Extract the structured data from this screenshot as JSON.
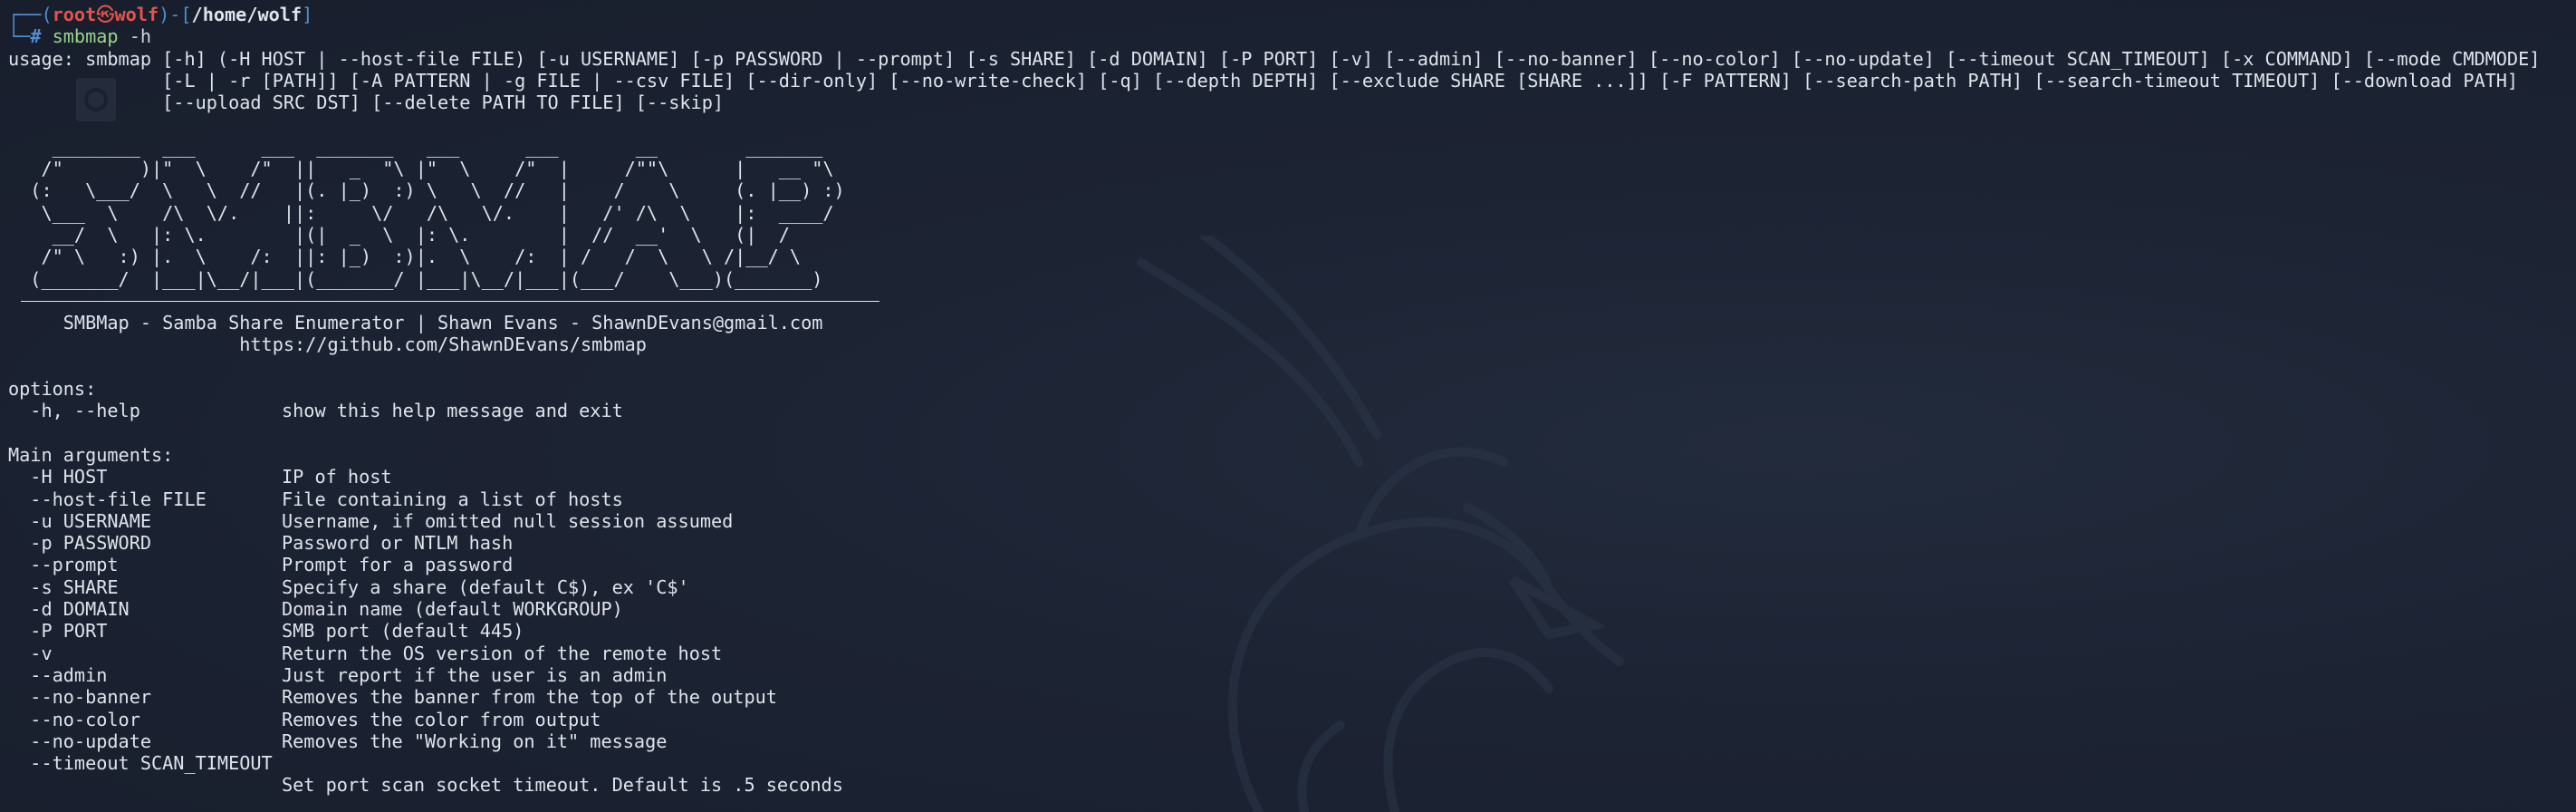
{
  "prompt": {
    "frame_top_left": "┌──(",
    "user": "root",
    "skull": "㉿",
    "host": "wolf",
    "mid": ")-[",
    "path": "/home/wolf",
    "close": "]",
    "frame_bottom": "└─",
    "hash": "# ",
    "command": "smbmap",
    "argument": " -h"
  },
  "usage_lines": [
    "usage: smbmap [-h] (-H HOST | --host-file FILE) [-u USERNAME] [-p PASSWORD | --prompt] [-s SHARE] [-d DOMAIN] [-P PORT] [-v] [--admin] [--no-banner] [--no-color] [--no-update] [--timeout SCAN_TIMEOUT] [-x COMMAND] [--mode CMDMODE]",
    "              [-L | -r [PATH]] [-A PATTERN | -g FILE | --csv FILE] [--dir-only] [--no-write-check] [-q] [--depth DEPTH] [--exclude SHARE [SHARE ...]] [-F PATTERN] [--search-path PATH] [--search-timeout TIMEOUT] [--download PATH]",
    "              [--upload SRC DST] [--delete PATH TO FILE] [--skip]"
  ],
  "banner_art": [
    "",
    "    ________  ___      ___  _______   ___      ___       __        _______",
    "   /\"       )|\"  \\    /\"  ||   _  \"\\ |\"  \\    /\"  |     /\"\"\\      |   __ \"\\",
    "  (:   \\___/  \\   \\  //   |(. |_)  :) \\   \\  //   |    /    \\     (. |__) :)",
    "   \\___  \\    /\\  \\/.    ||:     \\/   /\\   \\/.    |   /' /\\  \\    |:  ____/",
    "    __/  \\   |: \\.        |(|  _  \\  |: \\.        |  //  __'  \\   (|  /",
    "   /\" \\   :) |.  \\    /:  ||: |_)  :)|.  \\    /:  | /   /  \\   \\ /|__/ \\",
    "  (_______/  |___|\\__/|___|(_______/ |___|\\__/|___|(___/    \\___)(_______)"
  ],
  "banner_title": "     SMBMap - Samba Share Enumerator | Shawn Evans - ShawnDEvans@gmail.com",
  "banner_url": "                     https://github.com/ShawnDEvans/smbmap",
  "options_header": "options:",
  "options": [
    {
      "flag": "  -h, --help",
      "desc": "show this help message and exit"
    }
  ],
  "main_header": "Main arguments:",
  "main_args": [
    {
      "flag": "  -H HOST",
      "desc": "IP of host"
    },
    {
      "flag": "  --host-file FILE",
      "desc": "File containing a list of hosts"
    },
    {
      "flag": "  -u USERNAME",
      "desc": "Username, if omitted null session assumed"
    },
    {
      "flag": "  -p PASSWORD",
      "desc": "Password or NTLM hash"
    },
    {
      "flag": "  --prompt",
      "desc": "Prompt for a password"
    },
    {
      "flag": "  -s SHARE",
      "desc": "Specify a share (default C$), ex 'C$'"
    },
    {
      "flag": "  -d DOMAIN",
      "desc": "Domain name (default WORKGROUP)"
    },
    {
      "flag": "  -P PORT",
      "desc": "SMB port (default 445)"
    },
    {
      "flag": "  -v",
      "desc": "Return the OS version of the remote host"
    },
    {
      "flag": "  --admin",
      "desc": "Just report if the user is an admin"
    },
    {
      "flag": "  --no-banner",
      "desc": "Removes the banner from the top of the output"
    },
    {
      "flag": "  --no-color",
      "desc": "Removes the color from output"
    },
    {
      "flag": "  --no-update",
      "desc": "Removes the \"Working on it\" message"
    },
    {
      "flag": "  --timeout SCAN_TIMEOUT",
      "desc": ""
    },
    {
      "flag": "",
      "desc": "Set port scan socket timeout. Default is .5 seconds"
    }
  ],
  "colors": {
    "background": "#1b2231",
    "prompt_frame": "#4f8fd1",
    "prompt_user": "#e5534b",
    "command": "#9cd38a",
    "text": "#dfe3ec"
  },
  "icons": [
    "kali-dragon-wallpaper-icon",
    "desktop-file-icon"
  ]
}
